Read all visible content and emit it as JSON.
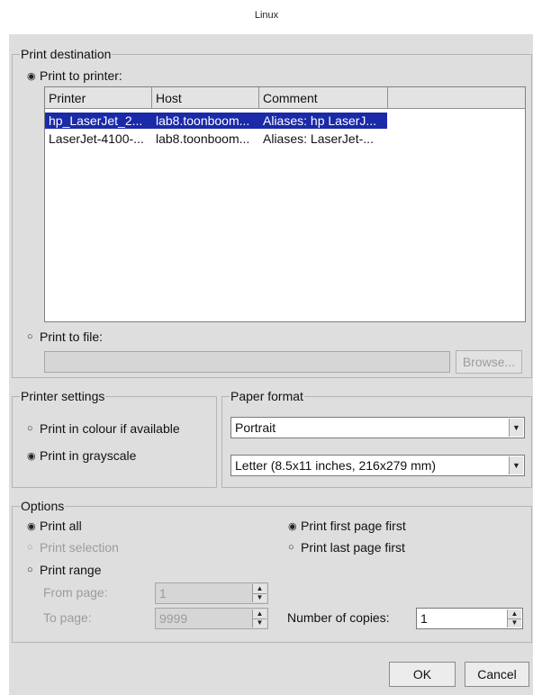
{
  "window": {
    "title": "Linux"
  },
  "destination": {
    "group_label": "Print destination",
    "print_to_printer": {
      "label": "Print to printer:",
      "checked": true
    },
    "printer_list": {
      "columns": [
        "Printer",
        "Host",
        "Comment"
      ],
      "rows": [
        {
          "printer": "hp_LaserJet_2...",
          "host": "lab8.toonboom...",
          "comment": "Aliases: hp LaserJ...",
          "selected": true
        },
        {
          "printer": "LaserJet-4100-...",
          "host": "lab8.toonboom...",
          "comment": "Aliases: LaserJet-...",
          "selected": false
        }
      ]
    },
    "print_to_file": {
      "label": "Print to file:",
      "checked": false,
      "path_value": ""
    },
    "browse_label": "Browse..."
  },
  "printer_settings": {
    "group_label": "Printer settings",
    "colour": {
      "label": "Print in colour if available",
      "checked": false
    },
    "grayscale": {
      "label": "Print in grayscale",
      "checked": true
    }
  },
  "paper_format": {
    "group_label": "Paper format",
    "orientation": "Portrait",
    "size": "Letter (8.5x11 inches, 216x279 mm)"
  },
  "options": {
    "group_label": "Options",
    "print_all": {
      "label": "Print all",
      "checked": true
    },
    "print_selection": {
      "label": "Print selection",
      "checked": false,
      "disabled": true
    },
    "print_range": {
      "label": "Print range",
      "checked": false
    },
    "from_page": {
      "label": "From page:",
      "value": "1"
    },
    "to_page": {
      "label": "To page:",
      "value": "9999"
    },
    "first_page_first": {
      "label": "Print first page first",
      "checked": true
    },
    "last_page_first": {
      "label": "Print last page first",
      "checked": false
    },
    "copies": {
      "label": "Number of copies:",
      "value": "1"
    }
  },
  "buttons": {
    "ok": "OK",
    "cancel": "Cancel"
  },
  "icons": {
    "radio_checked": "◉",
    "radio_unchecked": "○",
    "arrow_up": "▲",
    "arrow_down": "▼"
  }
}
